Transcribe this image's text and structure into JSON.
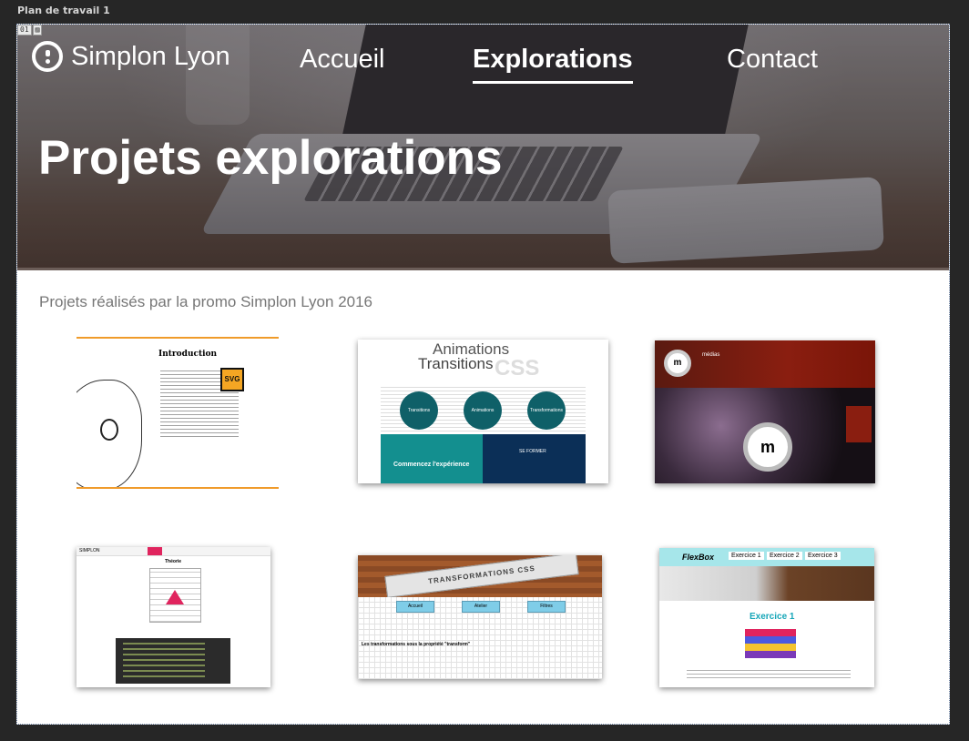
{
  "artboard": {
    "label": "Plan de travail 1",
    "badge_number": "01"
  },
  "site": {
    "brand": "Simplon Lyon",
    "nav": [
      {
        "label": "Accueil",
        "active": false
      },
      {
        "label": "Explorations",
        "active": true
      },
      {
        "label": "Contact",
        "active": false
      }
    ],
    "hero_title": "Projets explorations",
    "subtitle": "Projets réalisés par la promo Simplon Lyon 2016"
  },
  "thumbnails": {
    "t1": {
      "title": "Introduction",
      "badge": "SVG"
    },
    "t2": {
      "line1": "Animations",
      "line2": "Transitions",
      "css": "CSS",
      "circles": [
        "Transitions",
        "Animations",
        "Transformations"
      ],
      "cta": "Commencez l'expérience",
      "side": "SE FORMER"
    },
    "t3": {
      "brand": "médias",
      "logo": "m"
    },
    "t4": {
      "brand": "SIMPLON",
      "heading": "Théorie"
    },
    "t5": {
      "ruler": "TRANSFORMATIONS CSS",
      "buttons": [
        "Accueil",
        "Atelier",
        "Filtres"
      ],
      "heading": "Les transformations sous la propriété \"transform\""
    },
    "t6": {
      "brand": "FlexBox",
      "tabs": [
        "Exercice 1",
        "Exercice 2",
        "Exercice 3"
      ],
      "heading": "Exercice 1"
    }
  },
  "colors": {
    "accent_orange": "#f09b2a",
    "teal": "#138f8f",
    "navy": "#0b2f57",
    "pink": "#e0245e"
  }
}
